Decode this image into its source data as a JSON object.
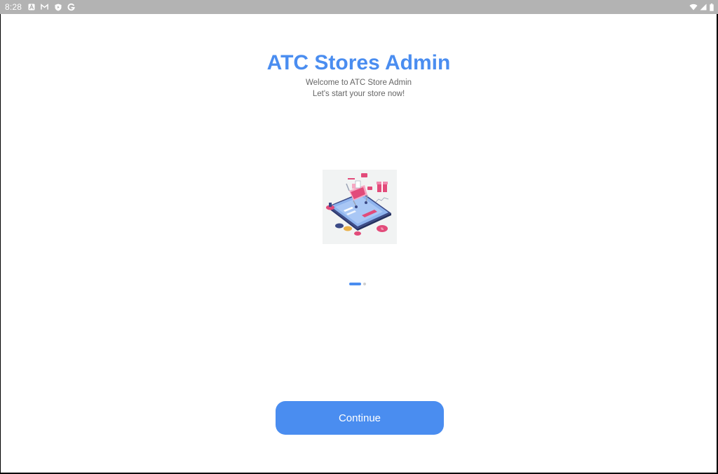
{
  "status_bar": {
    "time": "8:28",
    "left_icons": [
      "android-a-icon",
      "gmail-icon",
      "shield-play-icon",
      "google-g-icon"
    ],
    "right_icons": [
      "wifi-icon",
      "signal-icon",
      "battery-icon"
    ],
    "background": "#b3b3b3"
  },
  "onboarding": {
    "title": "ATC Stores Admin",
    "subtitle_line1": "Welcome to ATC Store Admin",
    "subtitle_line2": "Let's start your store now!",
    "illustration": "shopping-cart-phone-illustration",
    "pager": {
      "pages": 2,
      "current": 1
    },
    "continue_label": "Continue"
  },
  "colors": {
    "accent": "#4a8df0",
    "subtitle": "#666666",
    "background": "#ffffff"
  }
}
